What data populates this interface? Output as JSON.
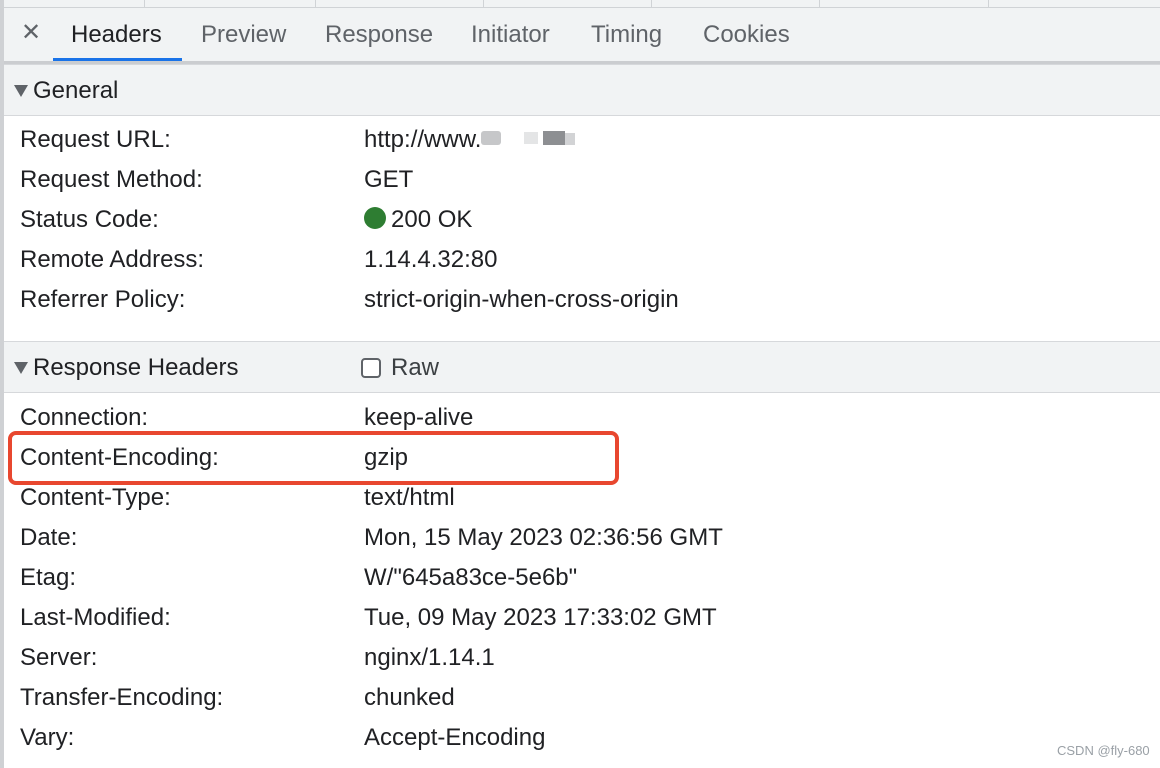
{
  "tabs": {
    "close_icon": "✕",
    "items": [
      "Headers",
      "Preview",
      "Response",
      "Initiator",
      "Timing",
      "Cookies"
    ],
    "active": "Headers"
  },
  "general": {
    "title": "General",
    "rows": [
      {
        "key": "Request URL:",
        "value": "http://www."
      },
      {
        "key": "Request Method:",
        "value": "GET"
      },
      {
        "key": "Status Code:",
        "value": "200 OK"
      },
      {
        "key": "Remote Address:",
        "value": "1.14.4.32:80"
      },
      {
        "key": "Referrer Policy:",
        "value": "strict-origin-when-cross-origin"
      }
    ]
  },
  "response_headers": {
    "title": "Response Headers",
    "raw_label": "Raw",
    "raw_checked": false,
    "rows": [
      {
        "key": "Connection:",
        "value": "keep-alive"
      },
      {
        "key": "Content-Encoding:",
        "value": "gzip"
      },
      {
        "key": "Content-Type:",
        "value": "text/html"
      },
      {
        "key": "Date:",
        "value": "Mon, 15 May 2023 02:36:56 GMT"
      },
      {
        "key": "Etag:",
        "value": "W/\"645a83ce-5e6b\""
      },
      {
        "key": "Last-Modified:",
        "value": "Tue, 09 May 2023 17:33:02 GMT"
      },
      {
        "key": "Server:",
        "value": "nginx/1.14.1"
      },
      {
        "key": "Transfer-Encoding:",
        "value": "chunked"
      },
      {
        "key": "Vary:",
        "value": "Accept-Encoding"
      }
    ]
  },
  "status_color": "#2e7d32",
  "highlight_color": "#e8472f",
  "accent_color": "#1a73e8",
  "watermark": "CSDN @fly-680"
}
